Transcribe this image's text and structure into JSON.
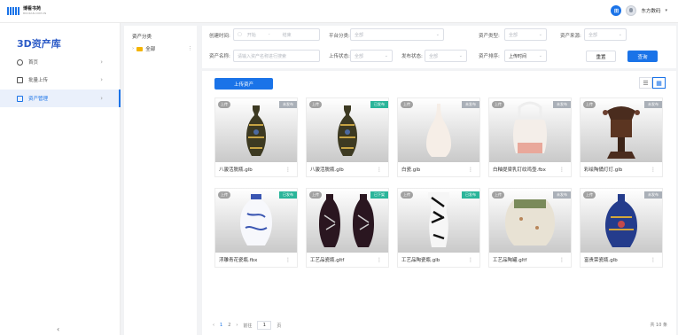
{
  "header": {
    "logo_text": "博看书苑",
    "logo_sub": "BOOKAN.COM.CN",
    "badge_text": "田",
    "user_name": "东方数码"
  },
  "nav": {
    "title": "3D资产库",
    "items": [
      {
        "label": "首页",
        "icon": "compass-icon"
      },
      {
        "label": "批量上传",
        "icon": "upload-icon"
      },
      {
        "label": "资产管理",
        "icon": "archive-icon",
        "active": true
      }
    ],
    "collapse_icon": "chevron-left-icon"
  },
  "category": {
    "title": "资产分类",
    "root": "全部"
  },
  "filters": {
    "created_label": "创建时间:",
    "start_placeholder": "开始",
    "range_sep": "-",
    "end_placeholder": "结束",
    "platform_label": "平台分类:",
    "platform_value": "全部",
    "type_label": "资产类型:",
    "type_value": "全部",
    "source_label": "资产来源:",
    "source_value": "全部",
    "name_label": "资产名称:",
    "name_placeholder": "请输入资产名称进行搜索",
    "upload_status_label": "上传状态:",
    "upload_status_value": "全部",
    "publish_status_label": "发布状态:",
    "publish_status_value": "全部",
    "sort_label": "资产排序:",
    "sort_value": "上传时间",
    "reset_label": "重置",
    "query_label": "查询"
  },
  "toolbar": {
    "upload_button": "上传资产",
    "view_list_icon": "list-icon",
    "view_grid_icon": "grid-icon"
  },
  "cards": [
    {
      "name": "八骏活脱瓶.glb",
      "upload_tag": "上传",
      "status": "未发布",
      "status_color": "#aab0b8",
      "thumb": "cloisonne-vase"
    },
    {
      "name": "八骏活脱瓶.glb",
      "upload_tag": "上传",
      "status": "已发布",
      "status_color": "#2bb59a",
      "thumb": "cloisonne-vase"
    },
    {
      "name": "白瓷.glb",
      "upload_tag": "上传",
      "status": "未发布",
      "status_color": "#aab0b8",
      "thumb": "white-vase"
    },
    {
      "name": "白釉提梁乳钉纹鸡壶.fbx",
      "upload_tag": "上传",
      "status": "未发布",
      "status_color": "#aab0b8",
      "thumb": "white-pot"
    },
    {
      "name": "彩绘陶俑灯灯.glb",
      "upload_tag": "上传",
      "status": "未发布",
      "status_color": "#aab0b8",
      "thumb": "bronze-lamp"
    },
    {
      "name": "浮雕青花瓷瓶.fbx",
      "upload_tag": "上传",
      "status": "已发布",
      "status_color": "#2bb59a",
      "thumb": "blue-white-vase"
    },
    {
      "name": "工艺品瓷瓶.gltf",
      "upload_tag": "上传",
      "status": "已下架",
      "status_color": "#2bb59a",
      "thumb": "twin-dark-vases"
    },
    {
      "name": "工艺品陶瓷瓶.glb",
      "upload_tag": "上传",
      "status": "已发布",
      "status_color": "#2bb59a",
      "thumb": "ink-vase"
    },
    {
      "name": "工艺品陶罐.gltf",
      "upload_tag": "上传",
      "status": "未发布",
      "status_color": "#aab0b8",
      "thumb": "clay-jar"
    },
    {
      "name": "富贵荣瓷瓶.glb",
      "upload_tag": "上传",
      "status": "未发布",
      "status_color": "#aab0b8",
      "thumb": "blue-cloisonne-vase"
    }
  ],
  "pagination": {
    "prev": "‹",
    "pages": [
      "1",
      "2"
    ],
    "next": "›",
    "goto_label": "前往",
    "goto_value": "1",
    "page_unit": "页",
    "total": "共 10 条"
  }
}
